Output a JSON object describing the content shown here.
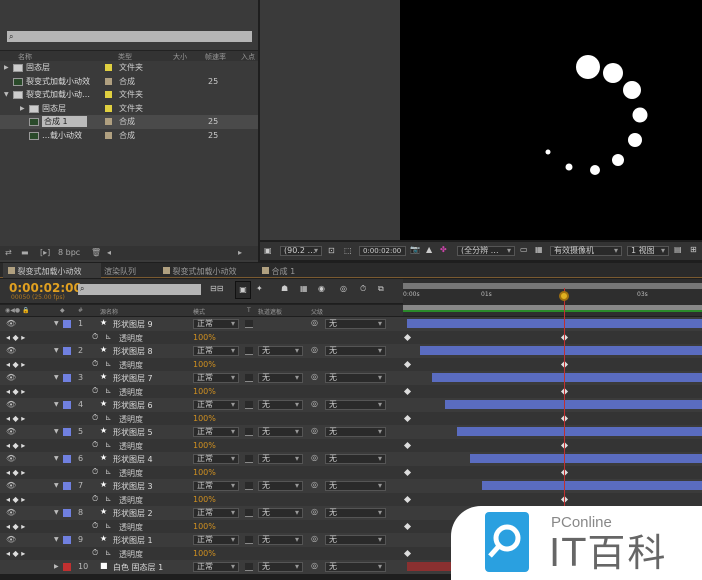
{
  "project": {
    "search_placeholder": "",
    "columns": [
      "名称",
      "类型",
      "大小",
      "帧速率",
      "入点"
    ],
    "items": [
      {
        "name": "固态层",
        "type": "文件夹",
        "fps": "",
        "kind": "folder",
        "indent": 0,
        "color": "#e0d040",
        "expanded": false
      },
      {
        "name": "裂变式加载小动效",
        "type": "合成",
        "fps": "25",
        "kind": "comp",
        "indent": 0,
        "color": "#b0a080",
        "expanded": false
      },
      {
        "name": "裂变式加载小动…",
        "type": "文件夹",
        "fps": "",
        "kind": "folder",
        "indent": 0,
        "color": "#e0d040",
        "expanded": true
      },
      {
        "name": "固态层",
        "type": "文件夹",
        "fps": "",
        "kind": "folder",
        "indent": 1,
        "color": "#e0d040",
        "expanded": false
      },
      {
        "name": "合成 1",
        "type": "合成",
        "fps": "25",
        "kind": "comp",
        "indent": 1,
        "color": "#b0a080",
        "selected": true
      },
      {
        "name": "…载小动效",
        "type": "合成",
        "fps": "25",
        "kind": "comp",
        "indent": 1,
        "color": "#b0a080"
      }
    ],
    "bpc": "8 bpc"
  },
  "viewer": {
    "zoom": "(90.2 …",
    "timecode": "0:00:02:00",
    "resolution": "(全分辨 …",
    "camera": "有效摄像机",
    "views": "1 视图"
  },
  "tabs": [
    "裂变式加载小动效",
    "渲染队列",
    "裂变式加载小动效",
    "合成 1"
  ],
  "timeline": {
    "current_time": "0:00:02:00",
    "frame_info": "00050 (25.00 fps)",
    "search_placeholder": "",
    "columns": {
      "num": "#",
      "source": "源名称",
      "mode": "模式",
      "t": "T",
      "trkmat": "轨道遮板",
      "parent": "父级"
    },
    "ruler": [
      "0:00s",
      "01s",
      "02s",
      "03s"
    ],
    "property_name": "透明度",
    "property_value": "100%",
    "layers": [
      {
        "num": "1",
        "name": "形状图层 9",
        "mode": "正常",
        "trkmat": "",
        "parent": "无",
        "color": "#7080e0",
        "start_s": 0.0
      },
      {
        "num": "2",
        "name": "形状图层 8",
        "mode": "正常",
        "trkmat": "无",
        "parent": "无",
        "color": "#7080e0",
        "start_s": 0.16
      },
      {
        "num": "3",
        "name": "形状图层 7",
        "mode": "正常",
        "trkmat": "无",
        "parent": "无",
        "color": "#7080e0",
        "start_s": 0.32
      },
      {
        "num": "4",
        "name": "形状图层 6",
        "mode": "正常",
        "trkmat": "无",
        "parent": "无",
        "color": "#7080e0",
        "start_s": 0.48
      },
      {
        "num": "5",
        "name": "形状图层 5",
        "mode": "正常",
        "trkmat": "无",
        "parent": "无",
        "color": "#7080e0",
        "start_s": 0.64
      },
      {
        "num": "6",
        "name": "形状图层 4",
        "mode": "正常",
        "trkmat": "无",
        "parent": "无",
        "color": "#7080e0",
        "start_s": 0.8
      },
      {
        "num": "7",
        "name": "形状图层 3",
        "mode": "正常",
        "trkmat": "无",
        "parent": "无",
        "color": "#7080e0",
        "start_s": 0.96
      },
      {
        "num": "8",
        "name": "形状图层 2",
        "mode": "正常",
        "trkmat": "无",
        "parent": "无",
        "color": "#7080e0",
        "start_s": 1.12
      },
      {
        "num": "9",
        "name": "形状图层 1",
        "mode": "正常",
        "trkmat": "无",
        "parent": "无",
        "color": "#7080e0",
        "start_s": 1.28
      },
      {
        "num": "10",
        "name": "白色 固态层 1",
        "mode": "正常",
        "trkmat": "无",
        "parent": "无",
        "color": "#c03030",
        "start_s": 0.0,
        "solid": true
      }
    ]
  },
  "watermark": {
    "brand": "PConline",
    "title": "IT百科"
  }
}
